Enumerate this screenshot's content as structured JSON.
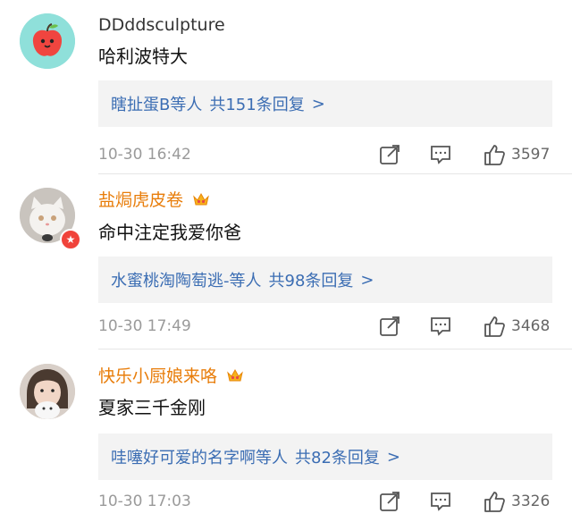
{
  "comments": [
    {
      "username": "DDddsculpture",
      "text": "哈利波特大",
      "replies_names": "瞎扯蛋B等人",
      "replies_count": "共151条回复",
      "time": "10-30 16:42",
      "likes": "3597"
    },
    {
      "username": "盐焗虎皮卷",
      "text": "命中注定我爱你爸",
      "replies_names": "水蜜桃淘陶萄逃-等人",
      "replies_count": "共98条回复",
      "time": "10-30 17:49",
      "likes": "3468"
    },
    {
      "username": "快乐小厨娘来咯",
      "text": "夏家三千金刚",
      "replies_names": "哇噻好可爱的名字啊等人",
      "replies_count": "共82条回复",
      "time": "10-30 17:03",
      "likes": "3326"
    }
  ],
  "reply_arrow": ">",
  "colors": {
    "username_vip": "#e87d0a",
    "link": "#3b6db3",
    "meta": "#9a9a9a"
  }
}
